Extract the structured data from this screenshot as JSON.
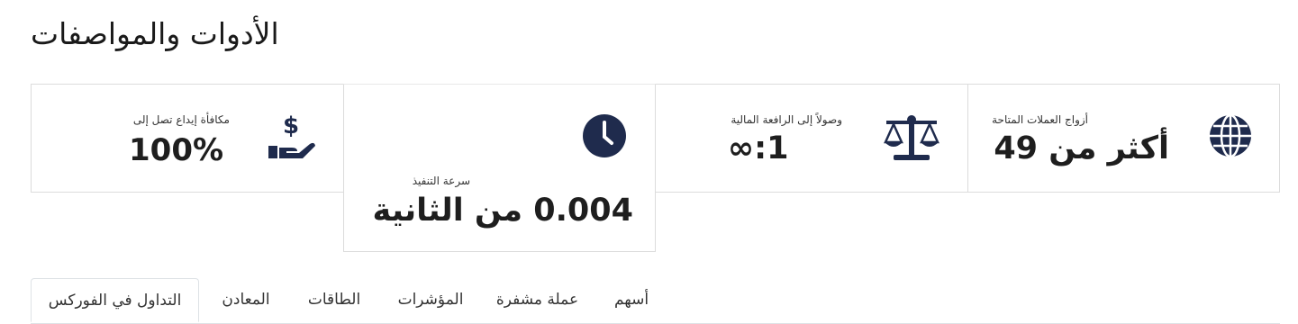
{
  "page": {
    "title": "الأدوات والمواصفات"
  },
  "features": [
    {
      "icon": "globe-icon",
      "label": "أزواج العملات المتاحة",
      "value": "أكثر من 49"
    },
    {
      "icon": "scale-icon",
      "label": "وصولاً إلى الرافعة المالية",
      "value": "∞:1"
    },
    {
      "icon": "clock-icon",
      "label": "سرعة التنفيذ",
      "value": "0.004 من الثانية"
    },
    {
      "icon": "dollar-hand-icon",
      "label": "مكافأة إيداع تصل إلى",
      "value": "100%"
    }
  ],
  "tabs": [
    {
      "label": "التداول في الفوركس",
      "active": true
    },
    {
      "label": "المعادن"
    },
    {
      "label": "الطاقات"
    },
    {
      "label": "المؤشرات"
    },
    {
      "label": "عملة مشفرة"
    },
    {
      "label": "أسهم"
    }
  ],
  "colors": {
    "icon": "#1f2b4d",
    "border": "#dcdcdc",
    "text": "#1a1a1a"
  }
}
